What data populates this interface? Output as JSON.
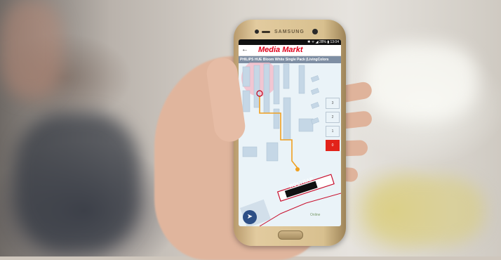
{
  "phone": {
    "brand": "SAMSUNG",
    "status_text": "✱ ᯤ ◢ 28% ▮ 13:04",
    "app": {
      "back_label": "←",
      "logo_text": "Media Markt",
      "product_title": "PHILIPS HUE Bloom White Single Pack (LivingColors",
      "floors": [
        "3",
        "2",
        "1",
        "0"
      ],
      "active_floor": "0",
      "escalator_label": "ROLTRAP",
      "beacon_label": "Online",
      "compass_icon": "compass-icon"
    }
  },
  "colors": {
    "accent_red": "#e2231a",
    "route_orange": "#f0a020",
    "map_background": "#eaf3f8",
    "product_bar": "#7e8ea3"
  }
}
